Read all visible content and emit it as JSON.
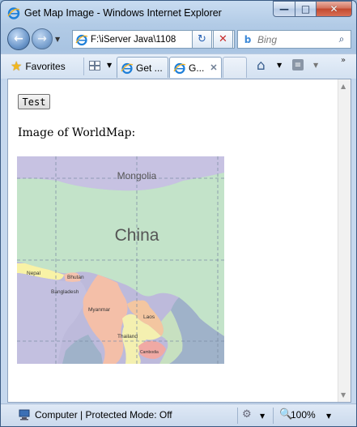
{
  "window": {
    "title": "Get Map Image - Windows Internet Explorer",
    "minimize_glyph": "—",
    "maximize_glyph": "□",
    "close_glyph": "✕"
  },
  "toolbar": {
    "address_value": "F:\\iServer Java\\1108",
    "search_placeholder": "Bing",
    "back_glyph": "←",
    "forward_glyph": "→",
    "refresh_glyph": "↻",
    "stop_glyph": "✕",
    "dropdown_glyph": "▼",
    "search_go_glyph": "⌕"
  },
  "tabs": {
    "favorites_label": "Favorites",
    "items": [
      {
        "label": "Get ...",
        "active": false
      },
      {
        "label": "G...",
        "active": true
      }
    ],
    "close_glyph": "✕",
    "home_glyph": "⌂",
    "feed_glyph": "≡",
    "chevron_glyph": "»"
  },
  "page": {
    "test_button_label": "Test",
    "image_label": "Image of WorldMap:",
    "map_labels": {
      "mongolia": "Mongolia",
      "china": "China",
      "nepal": "Nepal",
      "bhutan": "Bhutan",
      "bangladesh": "Bangladesh",
      "myanmar": "Myanmar",
      "laos": "Laos",
      "thailand": "Thailand",
      "cambodia": "Cambodia"
    }
  },
  "status": {
    "zone_text": "Computer | Protected Mode: Off",
    "zoom_text": "100%"
  },
  "colors": {
    "map_water": "#bdbadb",
    "map_china": "#c3e3c9",
    "map_mongolia": "#c7c2e2",
    "map_nepal": "#f8f2a6",
    "map_myanmar": "#f4bfa8",
    "map_laos": "#f3c6a0",
    "map_thailand": "#f4f0b0",
    "map_sea": "#9fb2c9"
  }
}
